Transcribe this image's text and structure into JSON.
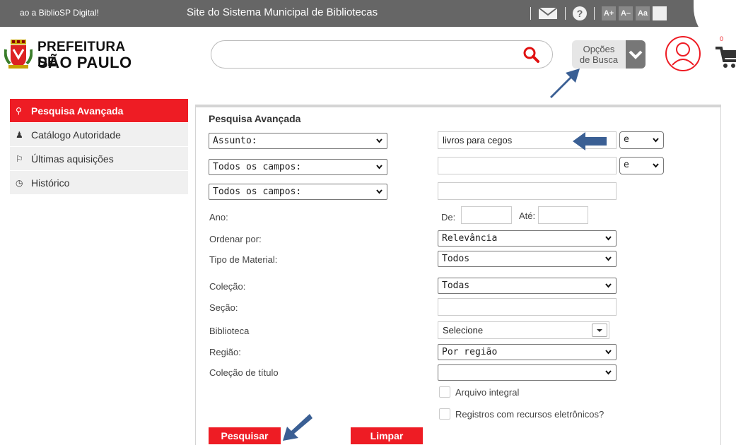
{
  "topbar": {
    "welcome": "ao a BiblioSP Digital!",
    "site_title": "Site do Sistema Municipal de Bibliotecas",
    "font_controls": [
      "A+",
      "A–",
      "Aa"
    ]
  },
  "header": {
    "logo_line1": "PREFEITURA DE",
    "logo_line2": "SÃO PAULO",
    "search_placeholder": "",
    "options_label_line1": "Opções",
    "options_label_line2": "de Busca",
    "cart_count": "0"
  },
  "sidebar": {
    "items": [
      {
        "label": "Pesquisa Avançada",
        "icon": "search-icon",
        "active": true
      },
      {
        "label": "Catálogo Autoridade",
        "icon": "person-icon",
        "active": false
      },
      {
        "label": "Últimas aquisições",
        "icon": "flag-icon",
        "active": false
      },
      {
        "label": "Histórico",
        "icon": "clock-icon",
        "active": false
      }
    ]
  },
  "form": {
    "title": "Pesquisa Avançada",
    "rows": [
      {
        "field": "Assunto:",
        "value": "livros para cegos",
        "operator": "e"
      },
      {
        "field": "Todos os campos:",
        "value": "",
        "operator": "e"
      },
      {
        "field": "Todos os campos:",
        "value": ""
      }
    ],
    "ano_label": "Ano:",
    "ano_de": "De:",
    "ano_ate": "Até:",
    "ordenar_label": "Ordenar por:",
    "ordenar_value": "Relevância",
    "tipo_label": "Tipo de Material:",
    "tipo_value": "Todos",
    "colecao_label": "Coleção:",
    "colecao_value": "Todas",
    "secao_label": "Seção:",
    "biblioteca_label": "Biblioteca",
    "biblioteca_value": "Selecione",
    "regiao_label": "Região:",
    "regiao_value": "Por região",
    "colecao_titulo_label": "Coleção de título",
    "colecao_titulo_value": "",
    "check_arquivo": "Arquivo integral",
    "check_registros": "Registros com recursos eletrônicos?",
    "btn_pesquisar": "Pesquisar",
    "btn_limpar": "Limpar"
  },
  "colors": {
    "accent": "#ee1c24",
    "topbar": "#666666",
    "pointer": "#3a5f94"
  }
}
